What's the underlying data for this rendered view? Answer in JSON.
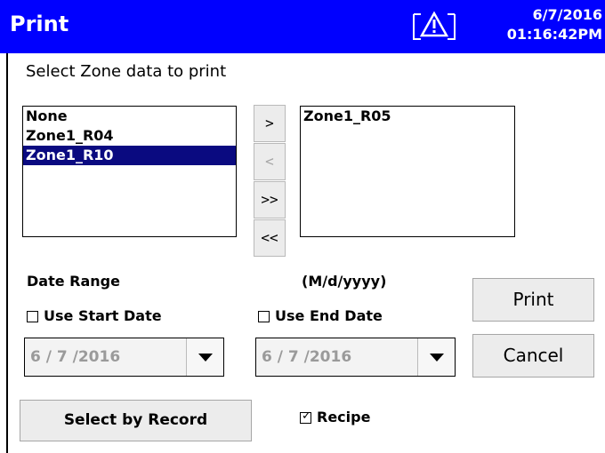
{
  "header": {
    "title": "Print",
    "date": "6/7/2016",
    "time": "01:16:42PM",
    "warning_icon": "warning-triangle-icon",
    "background_color": "#0000ff"
  },
  "zone_section": {
    "title": "Select Zone data to print",
    "available": [
      "None",
      "Zone1_R04",
      "Zone1_R10"
    ],
    "selected_available": "Zone1_R10",
    "chosen": [
      "Zone1_R05"
    ]
  },
  "transfer_buttons": {
    "add": ">",
    "remove": "<",
    "add_all": ">>",
    "remove_all": "<<"
  },
  "date_range": {
    "label": "Date Range",
    "format": "(M/d/yyyy)",
    "use_start_label": "Use Start Date",
    "use_start_checked": false,
    "use_end_label": "Use End Date",
    "use_end_checked": false,
    "start_value": "6 / 7 /2016",
    "end_value": "6 / 7 /2016"
  },
  "actions": {
    "print": "Print",
    "cancel": "Cancel",
    "select_by_record": "Select by Record"
  },
  "recipe": {
    "label": "Recipe",
    "checked": true
  }
}
